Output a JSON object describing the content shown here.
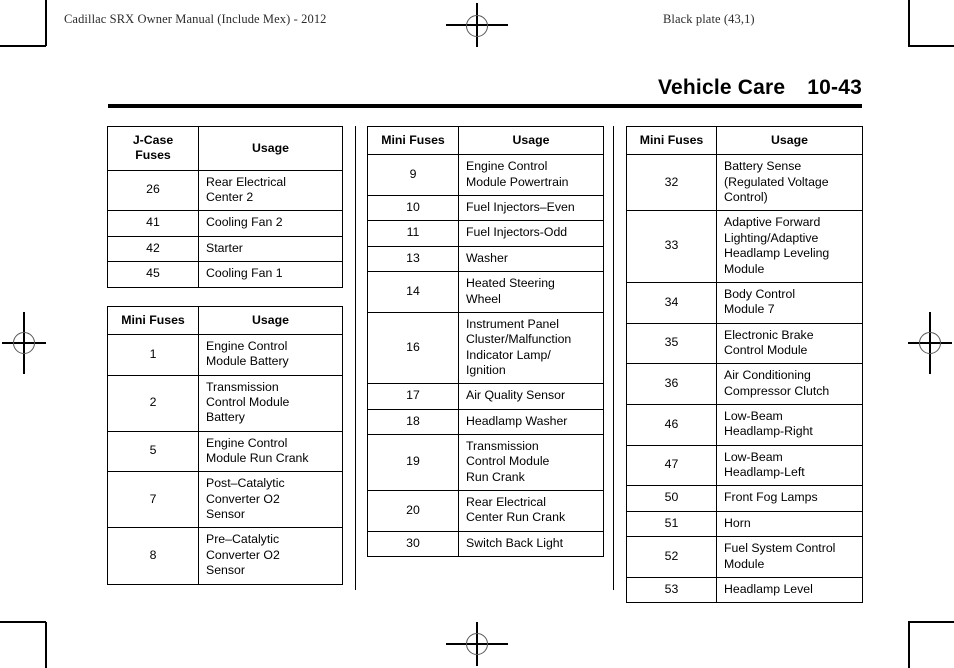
{
  "running_head": {
    "document_title": "Cadillac SRX Owner Manual (Include Mex) - 2012",
    "plate_info": "Black plate (43,1)"
  },
  "chapter": {
    "title": "Vehicle Care",
    "page_number": "10-43"
  },
  "columns": [
    {
      "tables": [
        {
          "id": "j-case-fuses",
          "headers": [
            "J-Case\nFuses",
            "Usage"
          ],
          "header_lines": [
            [
              "J-Case",
              "Fuses"
            ],
            [
              "Usage"
            ]
          ],
          "rows": [
            {
              "fuse": "26",
              "usage": [
                "Rear Electrical",
                "Center 2"
              ]
            },
            {
              "fuse": "41",
              "usage": [
                "Cooling Fan 2"
              ]
            },
            {
              "fuse": "42",
              "usage": [
                "Starter"
              ]
            },
            {
              "fuse": "45",
              "usage": [
                "Cooling Fan 1"
              ]
            }
          ]
        },
        {
          "id": "mini-fuses-1",
          "headers": [
            "Mini Fuses",
            "Usage"
          ],
          "header_lines": [
            [
              "Mini Fuses"
            ],
            [
              "Usage"
            ]
          ],
          "rows": [
            {
              "fuse": "1",
              "usage": [
                "Engine Control",
                "Module Battery"
              ]
            },
            {
              "fuse": "2",
              "usage": [
                "Transmission",
                "Control Module",
                "Battery"
              ]
            },
            {
              "fuse": "5",
              "usage": [
                "Engine Control",
                "Module Run Crank"
              ]
            },
            {
              "fuse": "7",
              "usage": [
                "Post–Catalytic",
                "Converter O2",
                "Sensor"
              ]
            },
            {
              "fuse": "8",
              "usage": [
                "Pre–Catalytic",
                "Converter O2",
                "Sensor"
              ]
            }
          ]
        }
      ]
    },
    {
      "tables": [
        {
          "id": "mini-fuses-2",
          "headers": [
            "Mini Fuses",
            "Usage"
          ],
          "header_lines": [
            [
              "Mini Fuses"
            ],
            [
              "Usage"
            ]
          ],
          "rows": [
            {
              "fuse": "9",
              "usage": [
                "Engine Control",
                "Module Powertrain"
              ]
            },
            {
              "fuse": "10",
              "usage": [
                "Fuel Injectors–Even"
              ]
            },
            {
              "fuse": "11",
              "usage": [
                "Fuel Injectors-Odd"
              ]
            },
            {
              "fuse": "13",
              "usage": [
                "Washer"
              ]
            },
            {
              "fuse": "14",
              "usage": [
                "Heated Steering",
                "Wheel"
              ]
            },
            {
              "fuse": "16",
              "usage": [
                "Instrument Panel",
                "Cluster/Malfunction",
                "Indicator Lamp/",
                "Ignition"
              ]
            },
            {
              "fuse": "17",
              "usage": [
                "Air Quality Sensor"
              ]
            },
            {
              "fuse": "18",
              "usage": [
                "Headlamp Washer"
              ]
            },
            {
              "fuse": "19",
              "usage": [
                "Transmission",
                "Control Module",
                "Run Crank"
              ]
            },
            {
              "fuse": "20",
              "usage": [
                "Rear Electrical",
                "Center Run Crank"
              ]
            },
            {
              "fuse": "30",
              "usage": [
                "Switch Back Light"
              ]
            }
          ]
        }
      ]
    },
    {
      "tables": [
        {
          "id": "mini-fuses-3",
          "headers": [
            "Mini Fuses",
            "Usage"
          ],
          "header_lines": [
            [
              "Mini Fuses"
            ],
            [
              "Usage"
            ]
          ],
          "rows": [
            {
              "fuse": "32",
              "usage": [
                "Battery Sense",
                "(Regulated Voltage",
                "Control)"
              ]
            },
            {
              "fuse": "33",
              "usage": [
                "Adaptive Forward",
                "Lighting/Adaptive",
                "Headlamp Leveling",
                "Module"
              ]
            },
            {
              "fuse": "34",
              "usage": [
                "Body Control",
                "Module 7"
              ]
            },
            {
              "fuse": "35",
              "usage": [
                "Electronic Brake",
                "Control Module"
              ]
            },
            {
              "fuse": "36",
              "usage": [
                "Air Conditioning",
                "Compressor Clutch"
              ]
            },
            {
              "fuse": "46",
              "usage": [
                "Low-Beam",
                "Headlamp-Right"
              ]
            },
            {
              "fuse": "47",
              "usage": [
                "Low-Beam",
                "Headlamp-Left"
              ]
            },
            {
              "fuse": "50",
              "usage": [
                "Front Fog Lamps"
              ]
            },
            {
              "fuse": "51",
              "usage": [
                "Horn"
              ]
            },
            {
              "fuse": "52",
              "usage": [
                "Fuel System Control",
                "Module"
              ]
            },
            {
              "fuse": "53",
              "usage": [
                "Headlamp Level"
              ]
            }
          ]
        }
      ]
    }
  ]
}
